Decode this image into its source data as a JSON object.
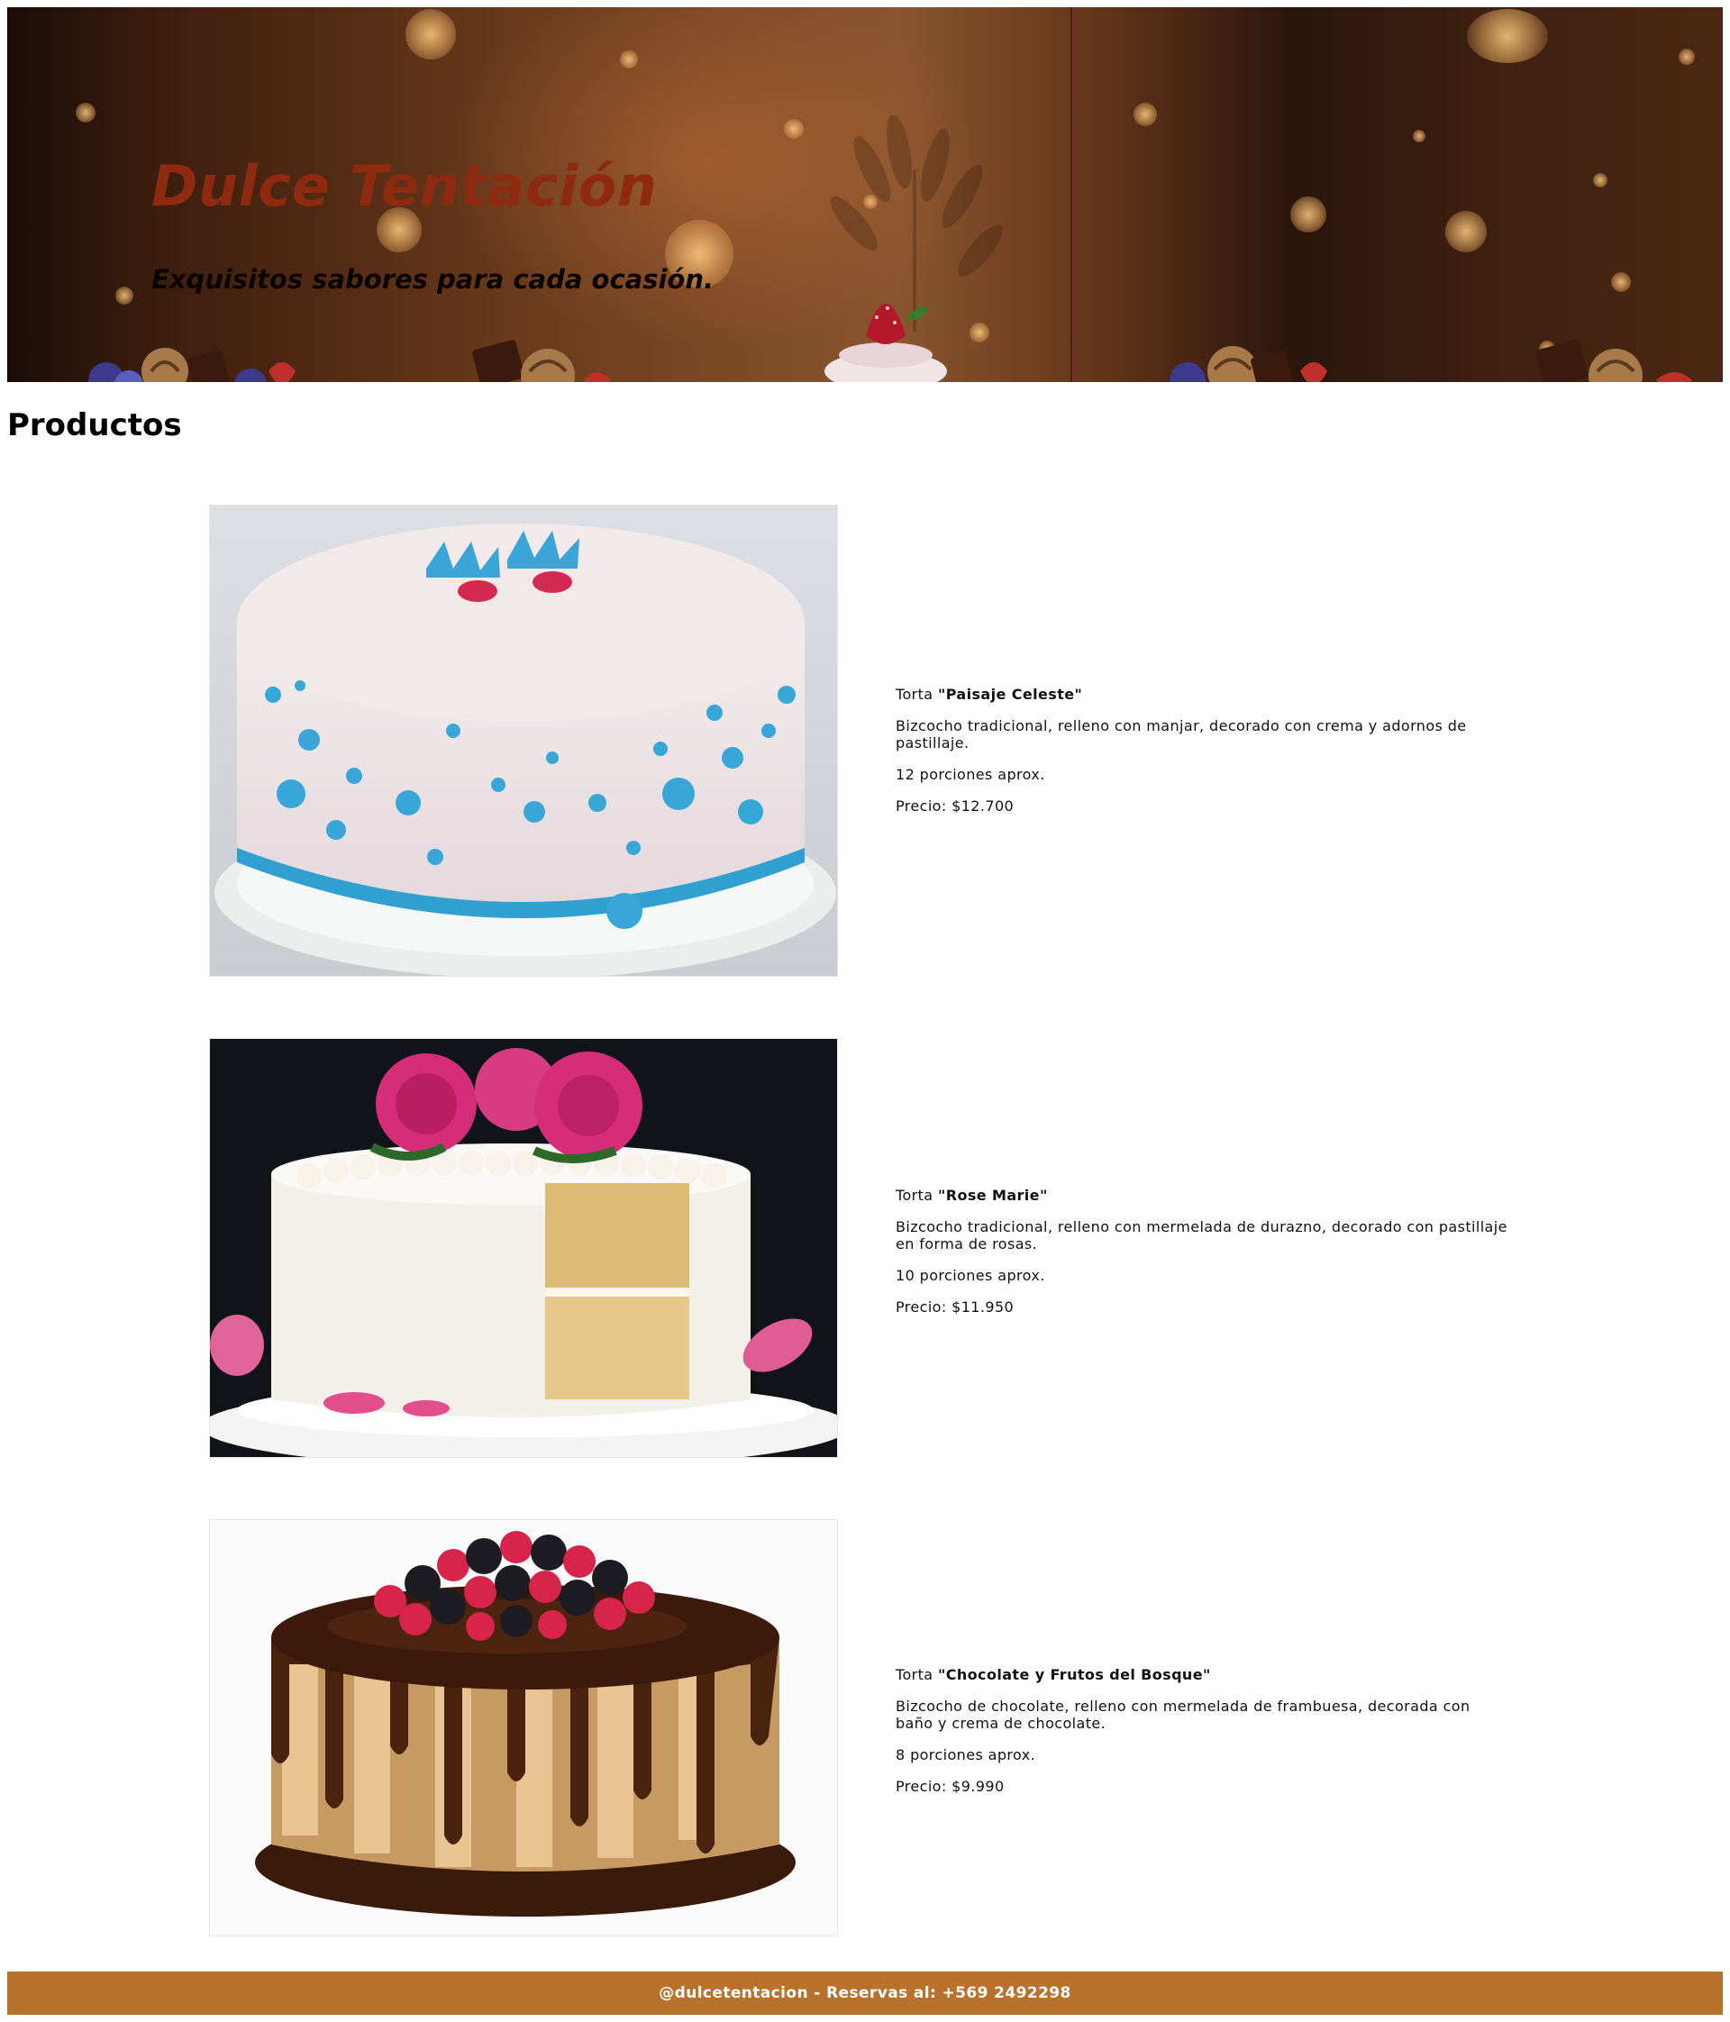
{
  "header": {
    "title": "Dulce Tentación",
    "subtitle": "Exquisitos sabores para cada ocasión."
  },
  "products_section": {
    "title": "Productos",
    "items": [
      {
        "prefix": "Torta",
        "name": "\"Paisaje Celeste\"",
        "description": "Bizcocho tradicional, relleno con manjar, decorado con crema y adornos de pastillaje.",
        "portions": "12 porciones aprox.",
        "price": "Precio: $12.700",
        "image": "blue-flower-fondant-cake"
      },
      {
        "prefix": "Torta",
        "name": "\"Rose Marie\"",
        "description": "Bizcocho tradicional, relleno con mermelada de durazno, decorado con pastillaje en forma de rosas.",
        "portions": "10 porciones aprox.",
        "price": "Precio: $11.950",
        "image": "rose-topped-cream-cake"
      },
      {
        "prefix": "Torta",
        "name": "\"Chocolate y Frutos del Bosque\"",
        "description": "Bizcocho de chocolate, relleno con mermelada de frambuesa, decorada con baño y crema de chocolate.",
        "portions": "8 porciones aprox.",
        "price": "Precio: $9.990",
        "image": "chocolate-berry-drip-cake"
      }
    ]
  },
  "footer": {
    "handle": "@dulcetentacion",
    "separator": " - ",
    "reservations": "Reservas al: +569 2492298"
  },
  "colors": {
    "title": "#8e2a10",
    "footer_bg": "#b8722c",
    "footer_text": "#ffffff"
  }
}
